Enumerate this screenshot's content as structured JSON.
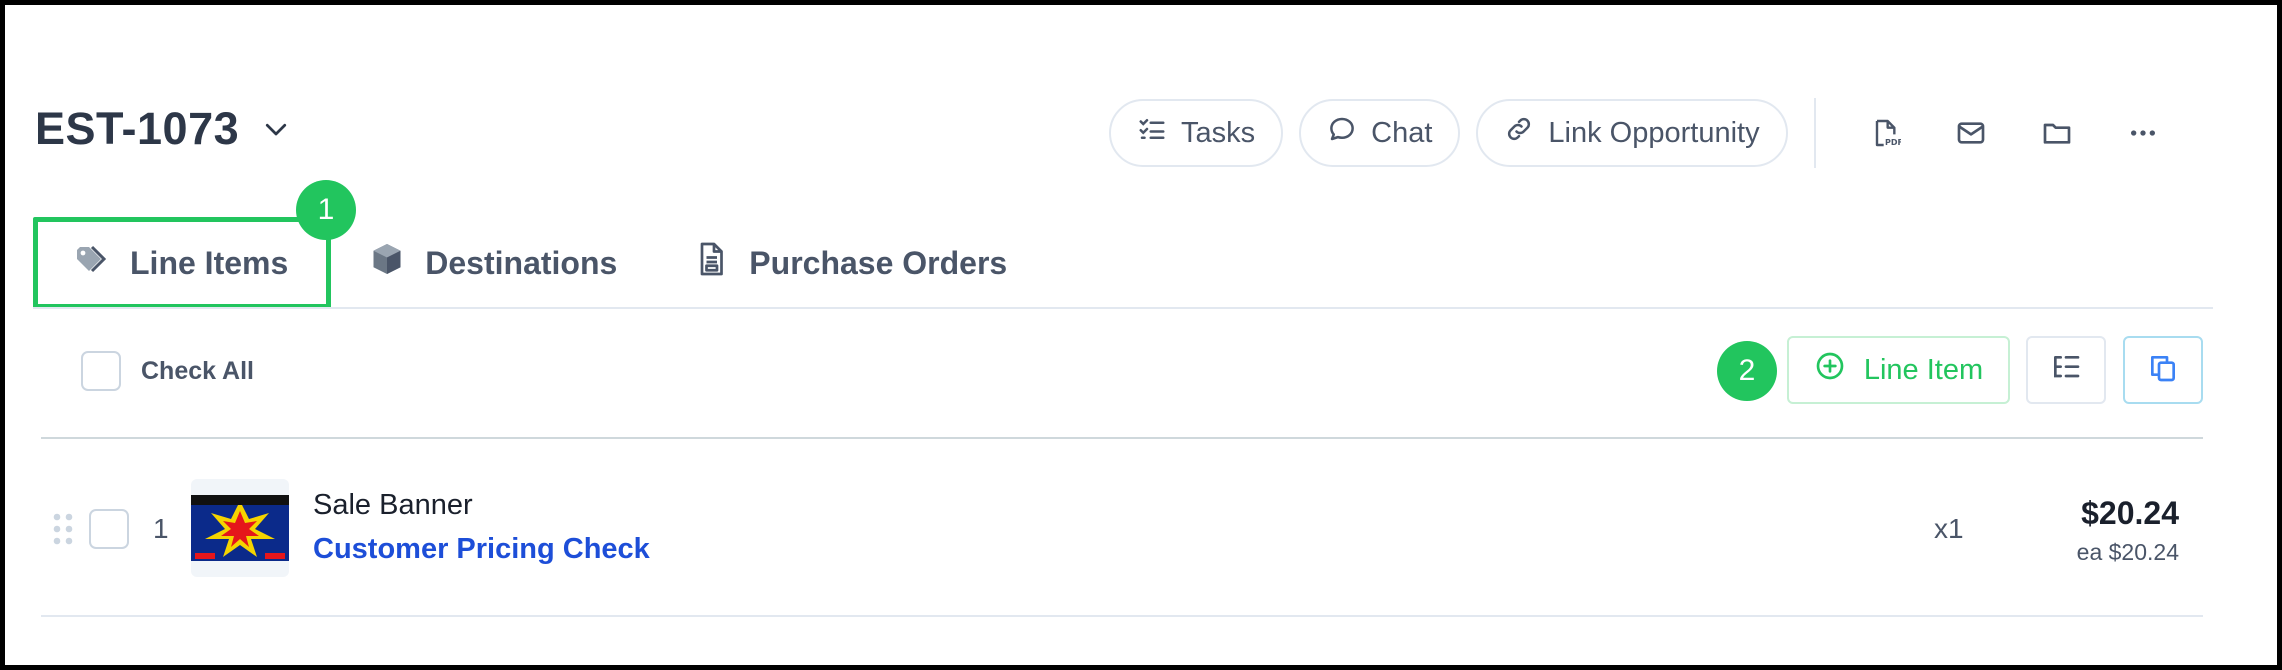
{
  "header": {
    "title": "EST-1073",
    "actions": {
      "tasks": "Tasks",
      "chat": "Chat",
      "link_opportunity": "Link Opportunity"
    },
    "icons": [
      "pdf-icon",
      "mail-icon",
      "folder-icon",
      "more-icon"
    ]
  },
  "tabs": [
    {
      "label": "Line Items",
      "icon": "tag-icon",
      "active": true
    },
    {
      "label": "Destinations",
      "icon": "box-icon",
      "active": false
    },
    {
      "label": "Purchase Orders",
      "icon": "document-icon",
      "active": false
    }
  ],
  "annotations": {
    "badge1": "1",
    "badge2": "2"
  },
  "toolbar": {
    "check_all": "Check All",
    "add_line_item": "Line Item"
  },
  "line_items": [
    {
      "number": "1",
      "name": "Sale Banner",
      "link": "Customer Pricing Check",
      "quantity": "x1",
      "price": "$20.24",
      "unit_price": "ea $20.24"
    }
  ],
  "colors": {
    "accent_green": "#22c55e",
    "link_blue": "#1d4ed8",
    "text_dark": "#2d3748"
  }
}
